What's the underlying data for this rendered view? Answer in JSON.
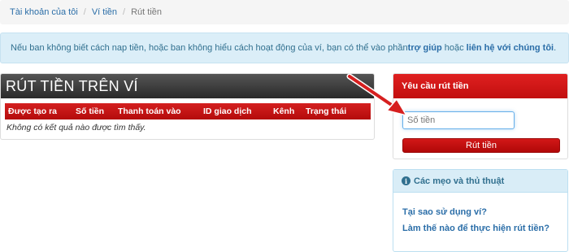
{
  "breadcrumb": {
    "items": [
      "Tài khoản của tôi",
      "Ví tiền"
    ],
    "current": "Rút tiền",
    "separator": "/"
  },
  "info": {
    "text_before": "Nếu ban không biết cách nap tiền, hoặc ban không hiểu cách hoạt động của ví, bạn có thể vào phần ",
    "help_link": "trợ giúp",
    "text_middle": " hoặc ",
    "contact_link": "liên hệ với chúng tôi",
    "text_after": "."
  },
  "wallet_panel": {
    "title": "RÚT TIỀN TRÊN VÍ",
    "columns": [
      "Được tạo ra",
      "Số tiền",
      "Thanh toán vào",
      "ID giao dịch",
      "Kênh",
      "Trạng thái"
    ],
    "rows": [],
    "empty_message": "Không có kết quả nào được tìm thấy."
  },
  "request_panel": {
    "title": "Yêu cầu rút tiền",
    "amount_placeholder": "Số tiền",
    "submit_label": "Rút tiền"
  },
  "tips_panel": {
    "icon": "info-circle-icon",
    "title": "Các mẹo và thủ thuật",
    "links": [
      "Tại sao sử dụng ví?",
      "Làm thế nào để thực hiện rút tiền?"
    ]
  },
  "colors": {
    "accent_red": "#c8102e",
    "link_blue": "#2b6ea8",
    "info_bg": "#dbeef8"
  }
}
